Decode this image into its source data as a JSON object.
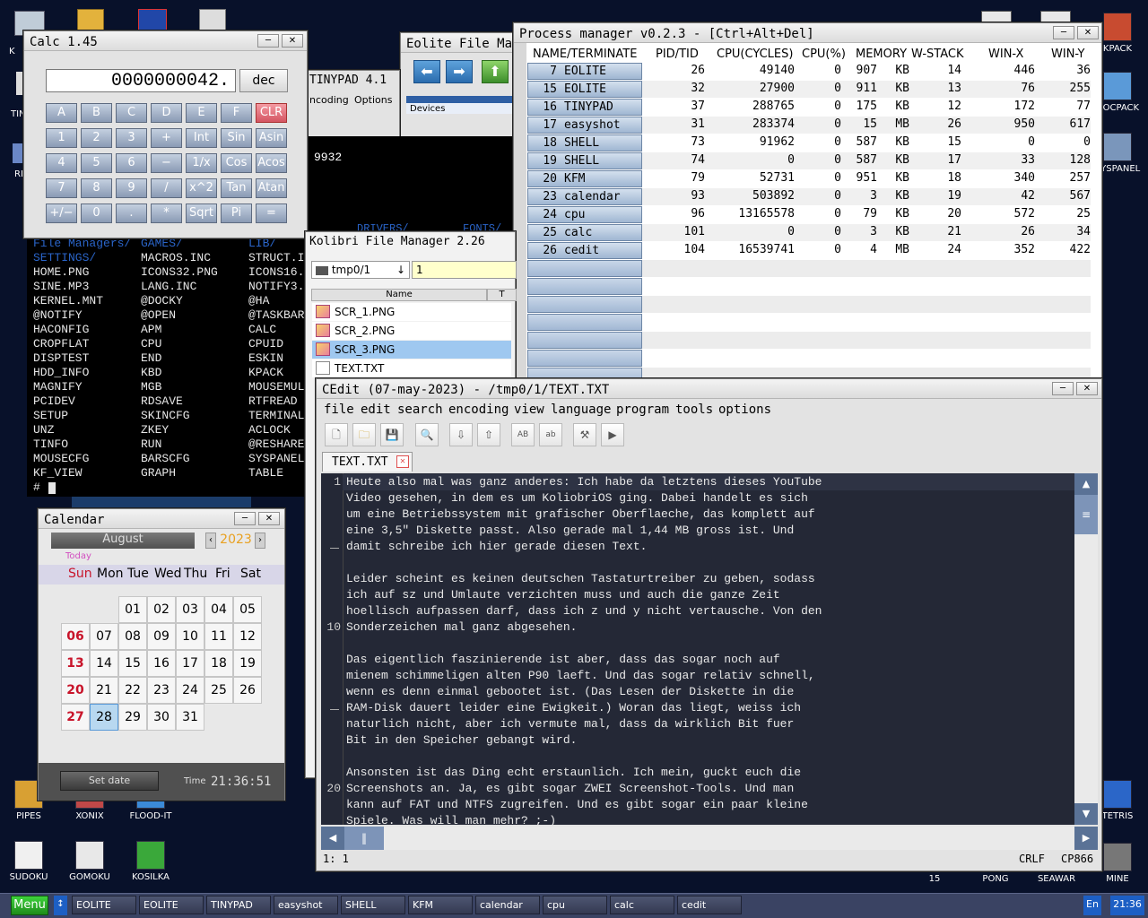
{
  "desktop": {
    "icons_left": [
      {
        "label": "PIPES"
      },
      {
        "label": "XONIX"
      },
      {
        "label": "FLOOD-IT"
      },
      {
        "label": "SUDOKU"
      },
      {
        "label": "GOMOKU"
      },
      {
        "label": "KOSILKA"
      }
    ],
    "icons_right": [
      {
        "label": "KPACK"
      },
      {
        "label": "DOCPACK"
      },
      {
        "label": "SYSPANEL"
      },
      {
        "label": "TETRIS"
      },
      {
        "label": "15"
      },
      {
        "label": "PONG"
      },
      {
        "label": "SEAWAR"
      },
      {
        "label": "MINE"
      }
    ],
    "partial_left_labels": [
      "K",
      "TIN",
      "RD"
    ]
  },
  "calc": {
    "title": "Calc 1.45",
    "display": "0000000042.",
    "mode": "dec",
    "rows": [
      [
        "A",
        "B",
        "C",
        "D",
        "E",
        "F",
        "CLR"
      ],
      [
        "1",
        "2",
        "3",
        "+",
        "Int",
        "Sin",
        "Asin"
      ],
      [
        "4",
        "5",
        "6",
        "−",
        "1/x",
        "Cos",
        "Acos"
      ],
      [
        "7",
        "8",
        "9",
        "/",
        "x^2",
        "Tan",
        "Atan"
      ],
      [
        "+/−",
        "0",
        ".",
        "*",
        "Sqrt",
        "Pi",
        "="
      ]
    ]
  },
  "tinypad": {
    "title": "TINYPAD 4.1",
    "menu": [
      "ncoding",
      "Options"
    ]
  },
  "eolite": {
    "title": "Eolite File Man",
    "sidebar_label": "Devices"
  },
  "terminal_bg": {
    "value": "9932",
    "top_labels": [
      "DRIVERS/",
      "FONTS/"
    ]
  },
  "terminal": {
    "header": [
      "File Managers/",
      "GAMES/",
      "LIB/"
    ],
    "rows": [
      [
        "SETTINGS/",
        "MACROS.INC",
        "STRUCT.I"
      ],
      [
        "HOME.PNG",
        "ICONS32.PNG",
        "ICONS16."
      ],
      [
        "SINE.MP3",
        "LANG.INC",
        "NOTIFY3."
      ],
      [
        "KERNEL.MNT",
        "@DOCKY",
        "@HA"
      ],
      [
        "@NOTIFY",
        "@OPEN",
        "@TASKBAR"
      ],
      [
        "HACONFIG",
        "APM",
        "CALC"
      ],
      [
        "CROPFLAT",
        "CPU",
        "CPUID"
      ],
      [
        "DISPTEST",
        "END",
        "ESKIN"
      ],
      [
        "HDD_INFO",
        "KBD",
        "KPACK"
      ],
      [
        "MAGNIFY",
        "MGB",
        "MOUSEMUL"
      ],
      [
        "PCIDEV",
        "RDSAVE",
        "RTFREAD"
      ],
      [
        "SETUP",
        "SKINCFG",
        "TERMINAL"
      ],
      [
        "UNZ",
        "ZKEY",
        "ACLOCK"
      ],
      [
        "TINFO",
        "RUN",
        "@RESHARE"
      ],
      [
        "MOUSECFG",
        "BARSCFG",
        "SYSPANEL"
      ],
      [
        "KF_VIEW",
        "GRAPH",
        "TABLE"
      ]
    ],
    "prompt": "#"
  },
  "process_manager": {
    "title": "Process manager v0.2.3 - [Ctrl+Alt+Del]",
    "headers": [
      "NAME/TERMINATE",
      "PID/TID",
      "CPU(CYCLES)",
      "CPU(%)",
      "MEMORY",
      "W-STACK",
      "WIN-X",
      "WIN-Y"
    ],
    "rows": [
      {
        "slot": "7",
        "name": "EOLITE",
        "pid": "26",
        "cycles": "49140",
        "cpu": "0",
        "mem": "907",
        "unit": "KB",
        "wstack": "14",
        "winx": "446",
        "winy": "36"
      },
      {
        "slot": "15",
        "name": "EOLITE",
        "pid": "32",
        "cycles": "27900",
        "cpu": "0",
        "mem": "911",
        "unit": "KB",
        "wstack": "13",
        "winx": "76",
        "winy": "255"
      },
      {
        "slot": "16",
        "name": "TINYPAD",
        "pid": "37",
        "cycles": "288765",
        "cpu": "0",
        "mem": "175",
        "unit": "KB",
        "wstack": "12",
        "winx": "172",
        "winy": "77"
      },
      {
        "slot": "17",
        "name": "easyshot",
        "pid": "31",
        "cycles": "283374",
        "cpu": "0",
        "mem": "15",
        "unit": "MB",
        "wstack": "26",
        "winx": "950",
        "winy": "617"
      },
      {
        "slot": "18",
        "name": "SHELL",
        "pid": "73",
        "cycles": "91962",
        "cpu": "0",
        "mem": "587",
        "unit": "KB",
        "wstack": "15",
        "winx": "0",
        "winy": "0"
      },
      {
        "slot": "19",
        "name": "SHELL",
        "pid": "74",
        "cycles": "0",
        "cpu": "0",
        "mem": "587",
        "unit": "KB",
        "wstack": "17",
        "winx": "33",
        "winy": "128"
      },
      {
        "slot": "20",
        "name": "KFM",
        "pid": "79",
        "cycles": "52731",
        "cpu": "0",
        "mem": "951",
        "unit": "KB",
        "wstack": "18",
        "winx": "340",
        "winy": "257"
      },
      {
        "slot": "23",
        "name": "calendar",
        "pid": "93",
        "cycles": "503892",
        "cpu": "0",
        "mem": "3",
        "unit": "KB",
        "wstack": "19",
        "winx": "42",
        "winy": "567"
      },
      {
        "slot": "24",
        "name": "cpu",
        "pid": "96",
        "cycles": "13165578",
        "cpu": "0",
        "mem": "79",
        "unit": "KB",
        "wstack": "20",
        "winx": "572",
        "winy": "25"
      },
      {
        "slot": "25",
        "name": "calc",
        "pid": "101",
        "cycles": "0",
        "cpu": "0",
        "mem": "3",
        "unit": "KB",
        "wstack": "21",
        "winx": "26",
        "winy": "34"
      },
      {
        "slot": "26",
        "name": "cedit",
        "pid": "104",
        "cycles": "16539741",
        "cpu": "0",
        "mem": "4",
        "unit": "MB",
        "wstack": "24",
        "winx": "352",
        "winy": "422"
      }
    ]
  },
  "kfm": {
    "title": "Kolibri File Manager 2.26",
    "path": "tmp0/1",
    "right_path": "1",
    "column_name": "Name",
    "column_type": "T",
    "files": [
      "SCR_1.PNG",
      "SCR_2.PNG",
      "SCR_3.PNG",
      "TEXT.TXT"
    ]
  },
  "cedit": {
    "title": "CEdit (07-may-2023) - /tmp0/1/TEXT.TXT",
    "menu": [
      "file",
      "edit",
      "search",
      "encoding",
      "view",
      "language",
      "program",
      "tools",
      "options"
    ],
    "tab": "TEXT.TXT",
    "tool_ab_upper": "AB",
    "tool_ab_lower": "ab",
    "line_numbers": [
      "1",
      "10",
      "20"
    ],
    "lines": [
      "Heute also mal was ganz anderes: Ich habe da letztens dieses YouTube",
      "Video gesehen, in dem es um KoliobriOS ging. Dabei handelt es sich",
      "um eine Betriebssystem mit grafischer Oberflaeche, das komplett auf",
      "eine 3,5\" Diskette passt. Also gerade mal 1,44 MB gross ist. Und",
      "damit schreibe ich hier gerade diesen Text.",
      "",
      "Leider scheint es keinen deutschen Tastaturtreiber zu geben, sodass",
      "ich auf sz und Umlaute verzichten muss und auch die ganze Zeit",
      "hoellisch aufpassen darf, dass ich z und y nicht vertausche. Von den",
      "Sonderzeichen mal ganz abgesehen.",
      "",
      "Das eigentlich faszinierende ist aber, dass das sogar noch auf",
      "mienem schimmeligen alten P90 laeft. Und das sogar relativ schnell,",
      "wenn es denn einmal gebootet ist. (Das Lesen der Diskette in die",
      "RAM-Disk dauert leider eine Ewigkeit.) Woran das liegt, weiss ich",
      "naturlich nicht, aber ich vermute mal, dass da wirklich Bit fuer",
      "Bit in den Speicher gebangt wird.",
      "",
      "Ansonsten ist das Ding echt erstaunlich. Ich mein, guckt euch die",
      "Screenshots an. Ja, es gibt sogar ZWEI Screenshot-Tools. Und man",
      "kann auf FAT und NTFS zugreifen. Und es gibt sogar ein paar kleine",
      "Spiele. Was will man mehr? ;-)"
    ],
    "status_pos": "1: 1",
    "status_eol": "CRLF",
    "status_enc": "CP866"
  },
  "calendar": {
    "title": "Calendar",
    "month": "August",
    "year": "2023",
    "today": "Today",
    "weekdays": [
      "Sun",
      "Mon",
      "Tue",
      "Wed",
      "Thu",
      "Fri",
      "Sat"
    ],
    "days": [
      "01",
      "02",
      "03",
      "04",
      "05",
      "06",
      "07",
      "08",
      "09",
      "10",
      "11",
      "12",
      "13",
      "14",
      "15",
      "16",
      "17",
      "18",
      "19",
      "20",
      "21",
      "22",
      "23",
      "24",
      "25",
      "26",
      "27",
      "28",
      "29",
      "30",
      "31"
    ],
    "selected": "28",
    "set_date": "Set date",
    "time_label": "Time",
    "time": "21:36:51"
  },
  "taskbar": {
    "menu": "Menu",
    "tasks": [
      "EOLITE",
      "EOLITE",
      "TINYPAD",
      "easyshot",
      "SHELL",
      "KFM",
      "calendar",
      "cpu",
      "calc",
      "cedit"
    ],
    "lang": "En",
    "clock": "21:36"
  },
  "colors": {
    "desktop": "#08112a",
    "taskbar": "#3a4363",
    "accent": "#2d6fb0",
    "clr_key": "#e26d78",
    "sunday": "#c8142a"
  }
}
